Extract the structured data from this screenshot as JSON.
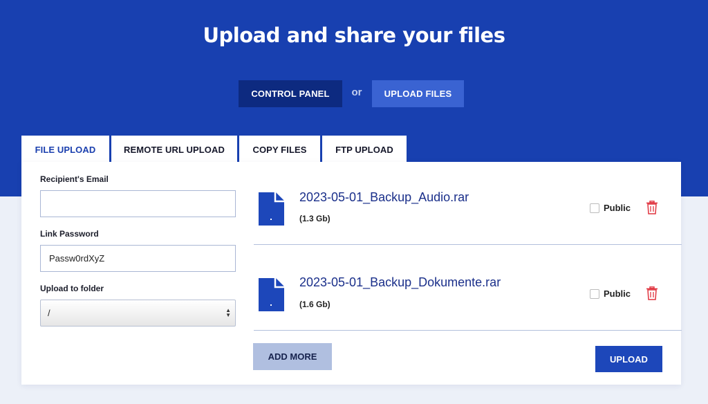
{
  "hero": {
    "title": "Upload and share your files",
    "control_panel_label": "CONTROL PANEL",
    "or_label": "or",
    "upload_files_label": "UPLOAD FILES"
  },
  "tabs": [
    {
      "label": "FILE UPLOAD",
      "active": true
    },
    {
      "label": "REMOTE URL UPLOAD",
      "active": false
    },
    {
      "label": "COPY FILES",
      "active": false
    },
    {
      "label": "FTP UPLOAD",
      "active": false
    }
  ],
  "form": {
    "recipient_email": {
      "label": "Recipient's Email",
      "value": "",
      "placeholder": ""
    },
    "link_password": {
      "label": "Link Password",
      "value": "Passw0rdXyZ"
    },
    "upload_folder": {
      "label": "Upload to folder",
      "selected": "/"
    }
  },
  "files": [
    {
      "name": "2023-05-01_Backup_Audio.rar",
      "size": "(1.3 Gb)",
      "public_label": "Public",
      "public_checked": false
    },
    {
      "name": "2023-05-01_Backup_Dokumente.rar",
      "size": "(1.6 Gb)",
      "public_label": "Public",
      "public_checked": false
    }
  ],
  "actions": {
    "add_more_label": "ADD MORE",
    "upload_label": "UPLOAD"
  },
  "icons": {
    "file": "file-icon",
    "delete": "trash-icon",
    "select_arrows": "chevron-up-down-icon"
  },
  "colors": {
    "hero_background": "#1840b0",
    "control_panel_button": "#0d2a80",
    "upload_files_button": "#3a63d2",
    "file_icon": "#1d47ba",
    "trash_icon": "#e0343f",
    "add_more_button": "#b0bfe0",
    "upload_button": "#1d47ba"
  }
}
